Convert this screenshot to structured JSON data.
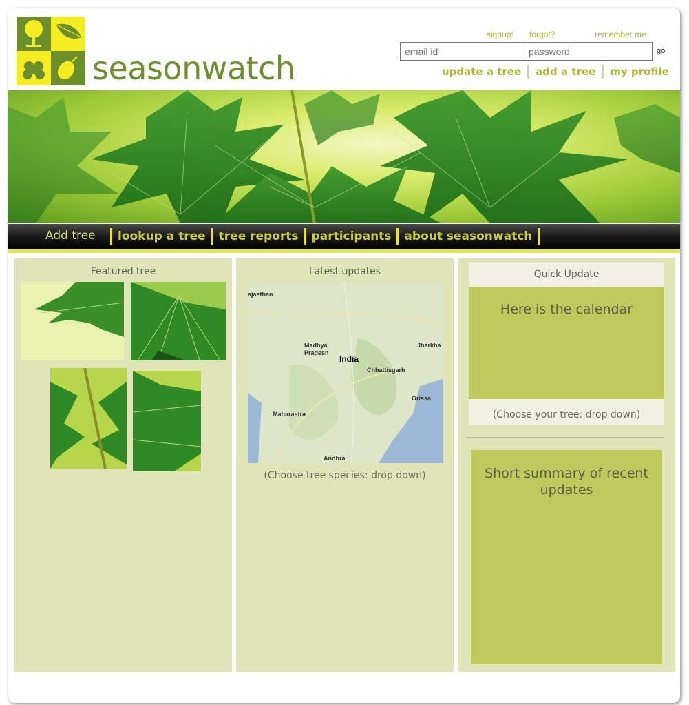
{
  "brand": {
    "name": "seasonwatch"
  },
  "login": {
    "signup": "signup!",
    "forgot": "forgot?",
    "remember": "remember me",
    "email_placeholder": "email id",
    "password_placeholder": "password",
    "go": "go"
  },
  "toplinks": [
    "update a tree",
    "add a tree",
    "my profile"
  ],
  "nav": {
    "active": "Add tree",
    "items": [
      "lookup a tree",
      "tree reports",
      "participants",
      "about seasonwatch"
    ]
  },
  "columns": {
    "featured": {
      "title": "Featured tree"
    },
    "latest": {
      "title": "Latest updates",
      "caption": "(Choose tree species: drop down)",
      "map_labels": [
        "ajasthan",
        "Madhya",
        "Pradesh",
        "India",
        "Jharkha",
        "Chhattisgarh",
        "Orissa",
        "Maharastra",
        "Andhra"
      ]
    },
    "quick": {
      "title": "Quick Update",
      "calendar": "Here is the calendar",
      "choose": "(Choose your tree: drop down)",
      "summary": "Short summary of recent updates"
    }
  },
  "colors": {
    "accent": "#aab63c",
    "olive": "#6c8f2c",
    "yellow": "#f6ec22",
    "panel": "#dfe5b8",
    "panel_dark": "#c0ca5c"
  },
  "icons": [
    "tree-icon",
    "leaf-icon",
    "flower-icon",
    "fruit-icon"
  ]
}
